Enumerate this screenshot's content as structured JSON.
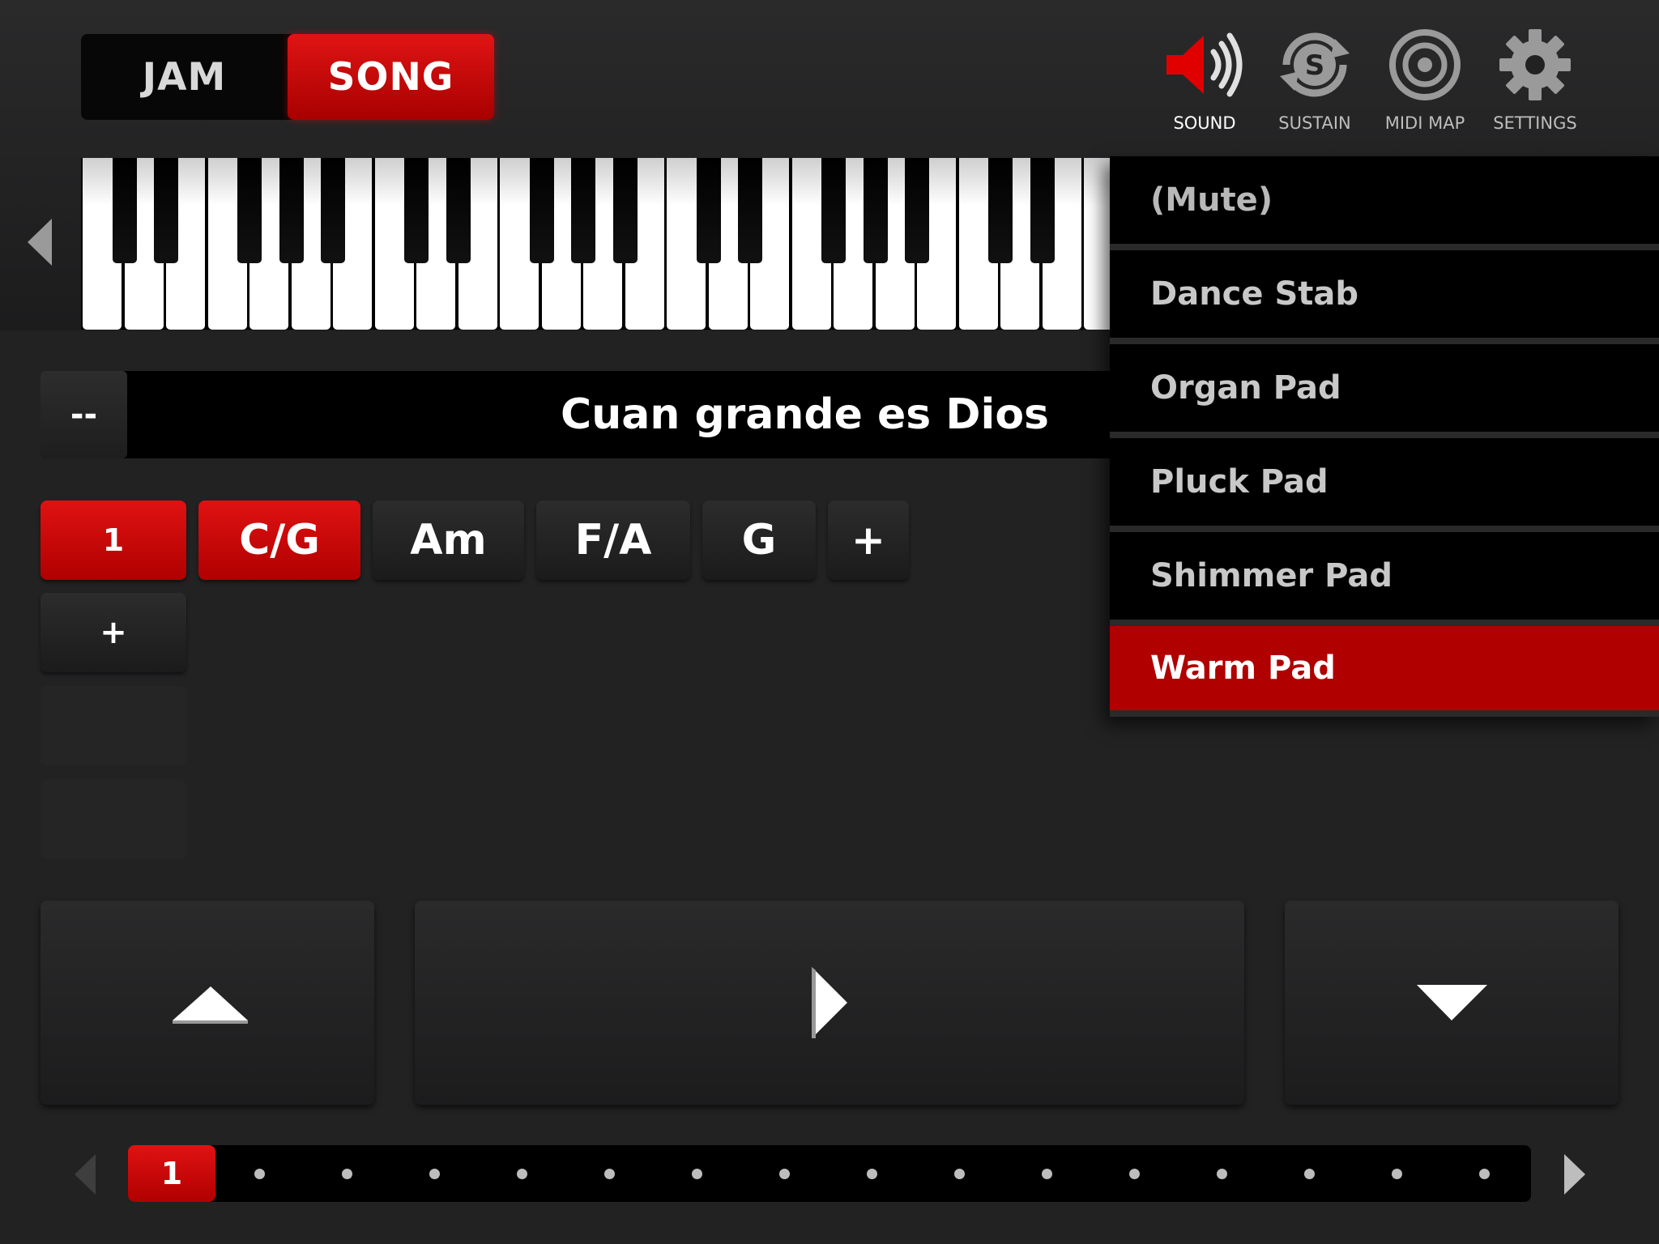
{
  "mode": {
    "jam_label": "JAM",
    "song_label": "SONG",
    "active": "SONG"
  },
  "toolbar": {
    "sound_label": "SOUND",
    "sustain_label": "SUSTAIN",
    "midi_map_label": "MIDI MAP",
    "settings_label": "SETTINGS"
  },
  "song": {
    "dash_label": "--",
    "title": "Cuan grande es Dios"
  },
  "chords": {
    "part_label": "1",
    "items": [
      "C/G",
      "Am",
      "F/A",
      "G"
    ],
    "add_label": "+",
    "add_part_label": "+"
  },
  "sections": {
    "current": "1"
  },
  "sound_menu": {
    "items": [
      "(Mute)",
      "Dance Stab",
      "Organ Pad",
      "Pluck Pad",
      "Shimmer Pad",
      "Warm Pad"
    ],
    "selected": "Warm Pad"
  },
  "colors": {
    "accent": "#c80000",
    "background": "#222223"
  }
}
